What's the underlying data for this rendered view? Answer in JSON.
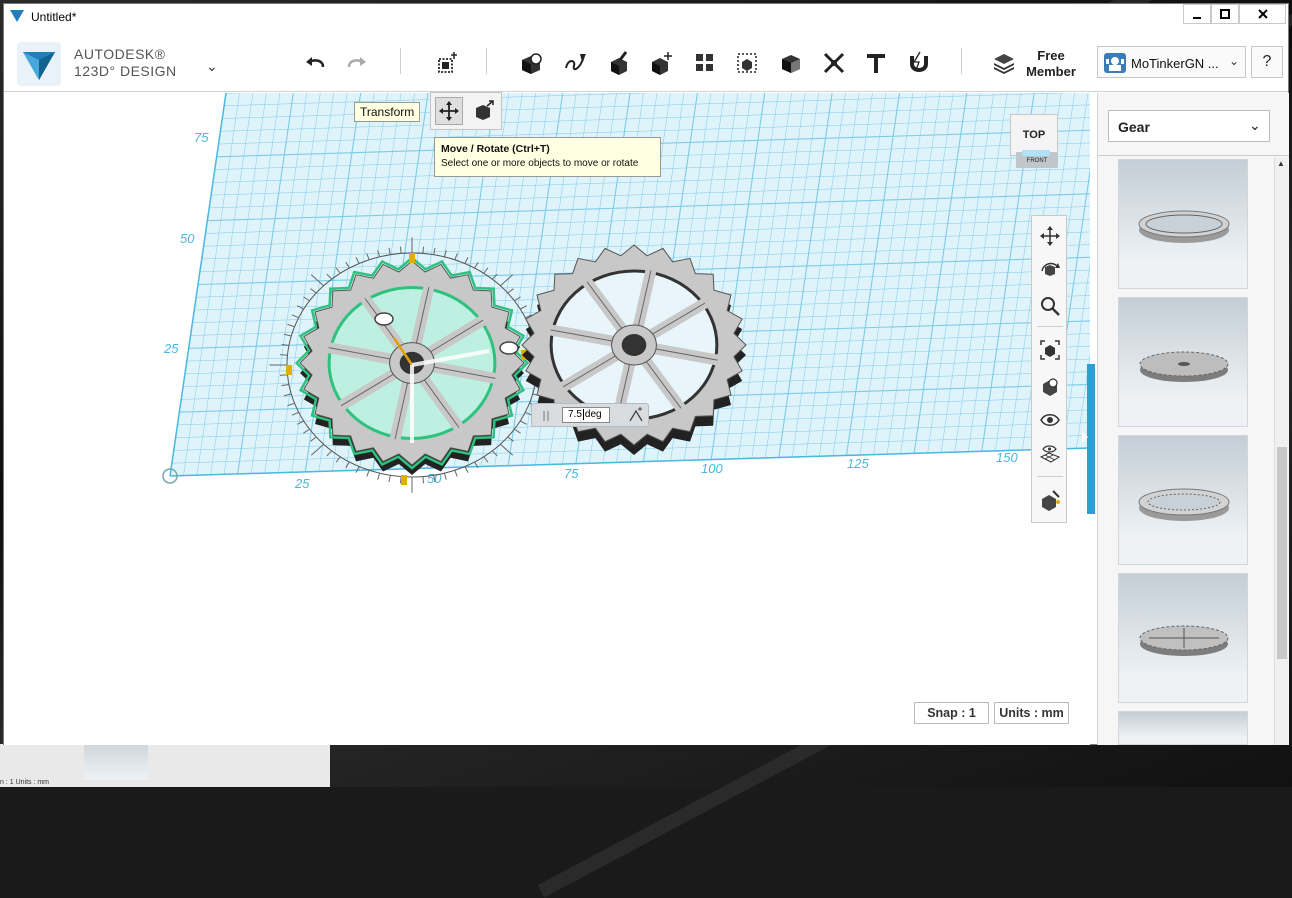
{
  "window": {
    "title": "Untitled*",
    "controls": {
      "minimize": "▁",
      "maximize": "□",
      "close": "✕"
    }
  },
  "brand": {
    "line1": "AUTODESK®",
    "line2": "123D° DESIGN",
    "chevron": "⌄"
  },
  "toolbar": {
    "tools": [
      "undo-icon",
      "redo-icon",
      "transform-icon",
      "primitives-icon",
      "sketch-icon",
      "construct-icon",
      "modify-icon",
      "pattern-icon",
      "grouping-icon",
      "combine-icon",
      "measure-icon",
      "text-icon",
      "snap-icon",
      "materials-icon"
    ],
    "free_member_line1": "Free",
    "free_member_line2": "Member",
    "user_name": "MoTinkerGN ...",
    "user_chevron": "⌄",
    "help": "?"
  },
  "transform_tooltip": "Transform",
  "command_tooltip": {
    "title": "Move / Rotate (Ctrl+T)",
    "description": "Select one or more objects to move or rotate"
  },
  "view_cube": {
    "top_label": "TOP",
    "front_label": "FRONT"
  },
  "grid": {
    "x_labels": [
      "25",
      "50",
      "75",
      "100",
      "125",
      "150"
    ],
    "y_labels": [
      "75",
      "50",
      "25"
    ]
  },
  "angle_input": {
    "value": "7.5",
    "unit": "deg"
  },
  "status": {
    "snap": "Snap : 1",
    "units": "Units : mm"
  },
  "right_panel": {
    "category": "Gear",
    "chevron": "⌄",
    "items": [
      "ring-gear-thumb",
      "spur-gear-thumb",
      "ring-gear-thumb-2",
      "spur-gear-thumb-2",
      "gear-thumb-5"
    ]
  },
  "colors": {
    "grid_line": "#7ccce8",
    "grid_bg": "#dff3fa",
    "selection": "#2ec27e",
    "gear_fill": "#c8c8c8",
    "accent": "#2a9fd6"
  },
  "taskbar_under": {
    "status_text": "n : 1  Units : mm"
  }
}
